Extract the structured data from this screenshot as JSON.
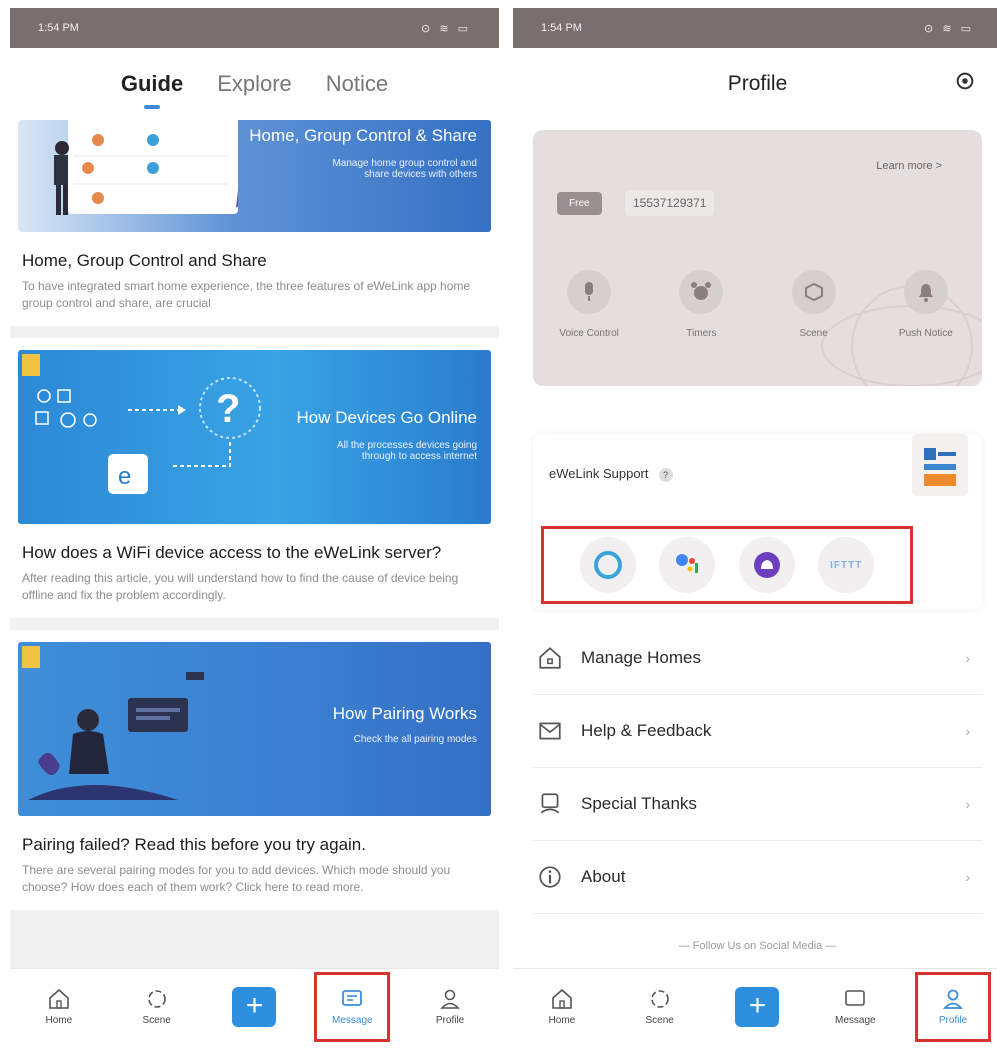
{
  "left": {
    "status": {
      "time": "1:54 PM",
      "icons": "⊙ ≋ ▭"
    },
    "tabs": [
      {
        "label": "Guide",
        "active": true
      },
      {
        "label": "Explore",
        "active": false
      },
      {
        "label": "Notice",
        "active": false
      }
    ],
    "cards": [
      {
        "banner_title": "Home, Group Control & Share",
        "banner_sub": "Manage home group control and share devices with others",
        "title": "Home, Group Control and Share",
        "desc": "To have integrated smart home experience, the three features of eWeLink app home group control and share, are crucial"
      },
      {
        "banner_title": "How Devices Go Online",
        "banner_sub": "All the processes devices going through to access internet",
        "title": "How does a WiFi device access to the eWeLink server?",
        "desc": "After reading this article, you will understand how to find the cause of device being offline and fix the problem accordingly."
      },
      {
        "banner_title": "How Pairing Works",
        "banner_sub": "Check the all pairing modes",
        "title": "Pairing failed? Read this before you try again.",
        "desc": "There are several pairing modes for you to add devices. Which mode should you choose? How does each of them work? Click here to read more."
      }
    ],
    "nav": [
      {
        "label": "Home",
        "icon": "home-icon"
      },
      {
        "label": "Scene",
        "icon": "scene-icon"
      },
      {
        "label": "",
        "icon": "add-icon"
      },
      {
        "label": "Message",
        "icon": "message-icon"
      },
      {
        "label": "Profile",
        "icon": "profile-icon"
      }
    ]
  },
  "right": {
    "status": {
      "time": "1:54 PM",
      "icons": "⊙ ≋ ▭"
    },
    "header": {
      "title": "Profile"
    },
    "account": {
      "learn_more": "Learn more >",
      "badge": "Free",
      "phone": "15537129371"
    },
    "features": [
      {
        "label": "Voice Control",
        "icon": "microphone-icon"
      },
      {
        "label": "Timers",
        "icon": "alarm-clock-icon"
      },
      {
        "label": "Scene",
        "icon": "scene-cube-icon"
      },
      {
        "label": "Push Notice",
        "icon": "bell-icon"
      }
    ],
    "support": {
      "title": "eWeLink Support",
      "help": "?",
      "assistants": [
        "Alexa",
        "Google Assistant",
        "Alice",
        "IFTTT"
      ],
      "ifttt_label": "IFTTT"
    },
    "menu": [
      {
        "label": "Manage Homes",
        "icon": "house-icon"
      },
      {
        "label": "Help & Feedback",
        "icon": "envelope-icon"
      },
      {
        "label": "Special Thanks",
        "icon": "heart-hand-icon"
      },
      {
        "label": "About",
        "icon": "info-icon"
      }
    ],
    "follow": "Follow Us on Social Media",
    "nav": [
      {
        "label": "Home"
      },
      {
        "label": "Scene"
      },
      {
        "label": ""
      },
      {
        "label": "Message"
      },
      {
        "label": "Profile"
      }
    ]
  },
  "colors": {
    "accent": "#3a8ed8",
    "highlight": "#d8332c",
    "statusbar": "#7a6f6f"
  }
}
